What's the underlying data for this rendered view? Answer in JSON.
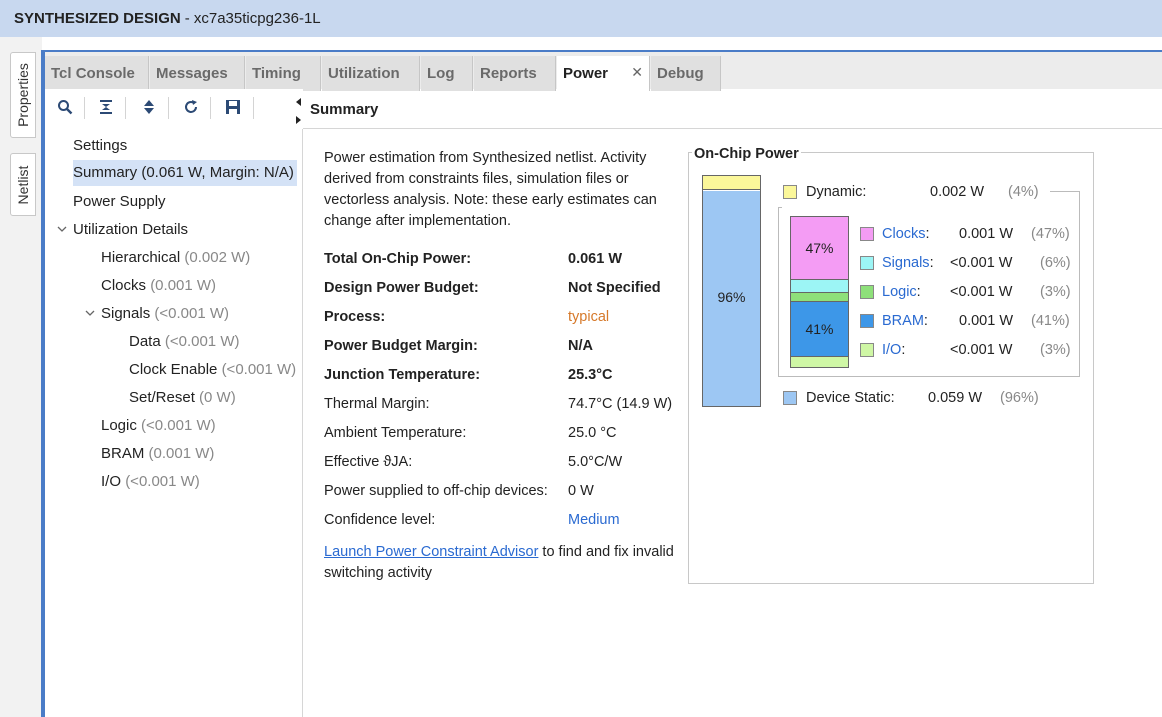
{
  "title": {
    "bold": "SYNTHESIZED DESIGN",
    "rest": " - xc7a35ticpg236-1L"
  },
  "side_tabs": {
    "properties": "Properties",
    "netlist": "Netlist"
  },
  "tabs": [
    {
      "label": "Tcl Console"
    },
    {
      "label": "Messages"
    },
    {
      "label": "Timing"
    },
    {
      "label": "Utilization"
    },
    {
      "label": "Log"
    },
    {
      "label": "Reports"
    },
    {
      "label": "Power",
      "close": "✕"
    },
    {
      "label": "Debug"
    }
  ],
  "header": {
    "title": "Summary"
  },
  "tree": {
    "settings": "Settings",
    "summary": "Summary (0.061 W, Margin: N/A)",
    "power_supply": "Power Supply",
    "utilization_details": "Utilization Details",
    "hierarchical": {
      "label": "Hierarchical",
      "value": "(0.002 W)"
    },
    "clocks": {
      "label": "Clocks",
      "value": "(0.001 W)"
    },
    "signals": {
      "label": "Signals",
      "value": "(<0.001 W)"
    },
    "data": {
      "label": "Data",
      "value": "(<0.001 W)"
    },
    "clock_enable": {
      "label": "Clock Enable",
      "value": "(<0.001 W)"
    },
    "set_reset": {
      "label": "Set/Reset",
      "value": "(0 W)"
    },
    "logic": {
      "label": "Logic",
      "value": "(<0.001 W)"
    },
    "bram": {
      "label": "BRAM",
      "value": "(0.001 W)"
    },
    "io": {
      "label": "I/O",
      "value": "(<0.001 W)"
    }
  },
  "summary": {
    "description": "Power estimation from Synthesized netlist. Activity derived from constraints files, simulation files or vectorless analysis. Note: these early estimates can change after implementation.",
    "rows": [
      {
        "k": "Total On-Chip Power:",
        "v": "0.061 W"
      },
      {
        "k": "Design Power Budget:",
        "v": "Not Specified"
      },
      {
        "k": "Process:",
        "v": "typical"
      },
      {
        "k": "Power Budget Margin:",
        "v": "N/A"
      },
      {
        "k": "Junction Temperature:",
        "v": "25.3°C"
      },
      {
        "k": "Thermal Margin:",
        "v": "74.7°C (14.9 W)"
      },
      {
        "k": "Ambient Temperature:",
        "v": "25.0 °C"
      },
      {
        "k": "Effective ϑJA:",
        "v": "5.0°C/W"
      },
      {
        "k": "Power supplied to off-chip devices:",
        "v": "0 W"
      },
      {
        "k": "Confidence level:",
        "v": "Medium"
      }
    ],
    "advisor_link": "Launch Power Constraint Advisor",
    "advisor_rest": " to find and fix invalid switching activity"
  },
  "on_chip": {
    "title": "On-Chip Power",
    "bar_static_pct": "96%",
    "dynamic": {
      "label": "Dynamic:",
      "watts": "0.002 W",
      "pct": "(4%)",
      "color": "#fbf79a"
    },
    "device_static": {
      "label": "Device Static:",
      "watts": "0.059 W",
      "pct": "(96%)",
      "color": "#9dc7f3"
    },
    "breakdown": [
      {
        "label": "Clocks",
        "colon": ":",
        "watts": "0.001 W",
        "pct": "(47%)",
        "color": "#f49cf4",
        "bar_label": "47%"
      },
      {
        "label": "Signals",
        "colon": ":",
        "watts": "<0.001 W",
        "pct": "(6%)",
        "color": "#9cf5f5",
        "bar_label": ""
      },
      {
        "label": "Logic",
        "colon": ":",
        "watts": "<0.001 W",
        "pct": "(3%)",
        "color": "#8ee07a",
        "bar_label": ""
      },
      {
        "label": "BRAM",
        "colon": ":",
        "watts": "0.001 W",
        "pct": "(41%)",
        "color": "#3d97e8",
        "bar_label": "41%"
      },
      {
        "label": "I/O",
        "colon": ":",
        "watts": "<0.001 W",
        "pct": "(3%)",
        "color": "#cff7a5",
        "bar_label": ""
      }
    ]
  }
}
